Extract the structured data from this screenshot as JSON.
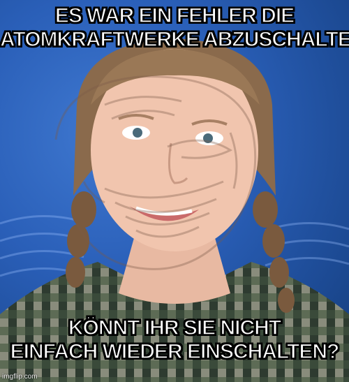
{
  "meme": {
    "top_text_line1": "ES WAR EIN FEHLER DIE",
    "top_text_line2": "ATOMKRAFTWERKE ABZUSCHALTEN",
    "bottom_text_line1": "KÖNNT IHR SIE NICHT",
    "bottom_text_line2": "EINFACH WIEDER EINSCHALTEN?",
    "watermark": "imgflip.com"
  },
  "colors": {
    "background_blue": "#2a5fb8",
    "caption_text": "#ffffff",
    "caption_outline": "#000000"
  }
}
